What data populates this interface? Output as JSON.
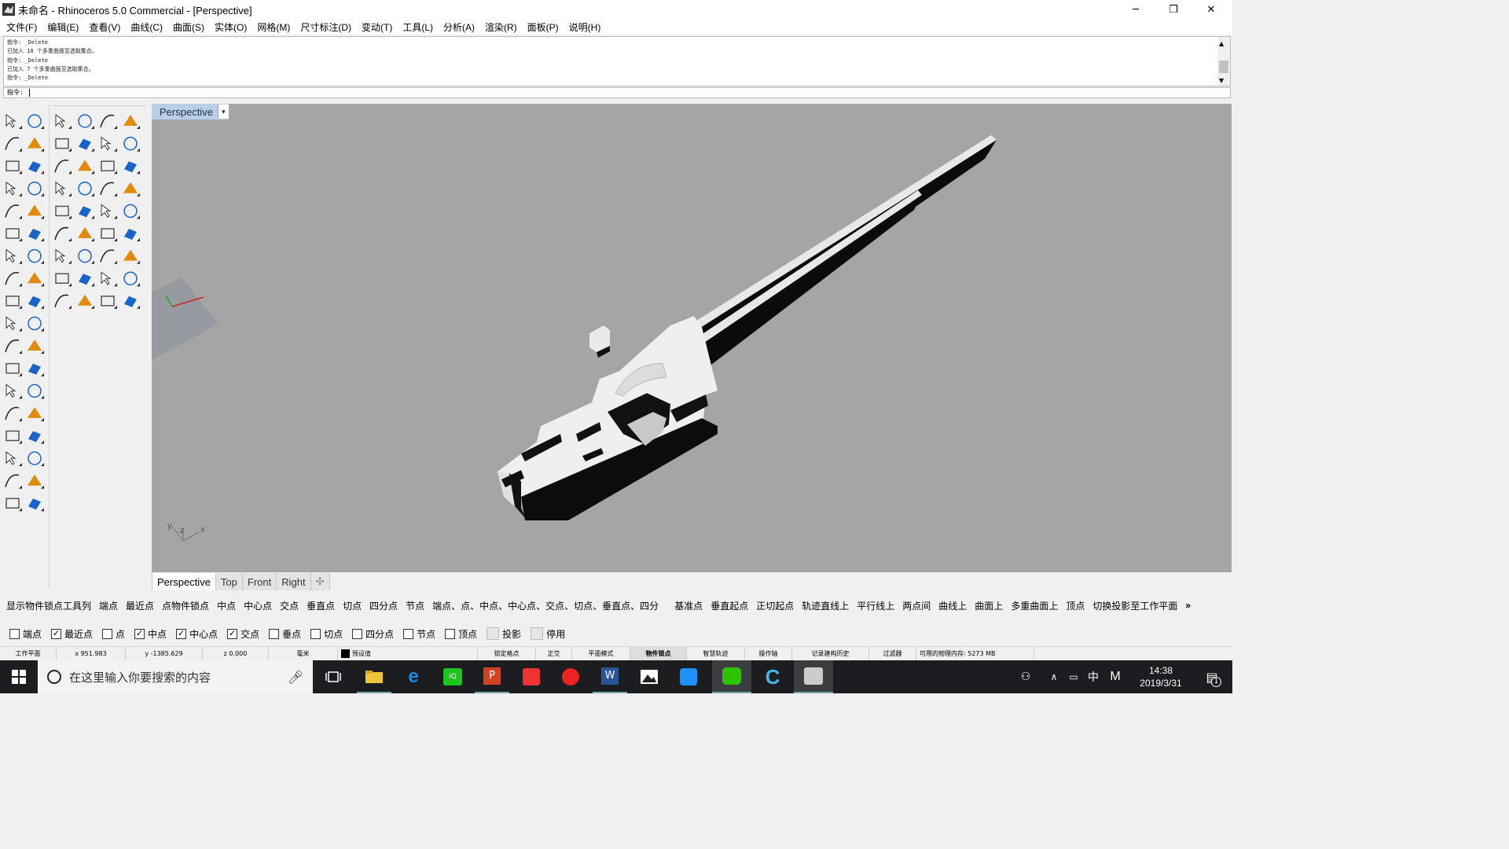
{
  "window": {
    "title": "未命名 - Rhinoceros 5.0 Commercial - [Perspective]",
    "minimize_glyph": "─",
    "restore_glyph": "❐",
    "close_glyph": "✕"
  },
  "menu": [
    "文件(F)",
    "编辑(E)",
    "查看(V)",
    "曲线(C)",
    "曲面(S)",
    "实体(O)",
    "网格(M)",
    "尺寸标注(D)",
    "变动(T)",
    "工具(L)",
    "分析(A)",
    "渲染(R)",
    "面板(P)",
    "说明(H)"
  ],
  "command_history": [
    "指令: _Delete",
    "已加入 10 个多重曲面至选取集合。",
    "指令: _Delete",
    "已加入 7 个多重曲面至选取集合。",
    "指令: _Delete"
  ],
  "command_prompt": "指令:",
  "viewport": {
    "title": "Perspective",
    "dropdown_glyph": "▾",
    "background_color": "#a5a5a5",
    "axis_labels": {
      "x": "x",
      "y": "y",
      "z": "z"
    }
  },
  "view_tabs": [
    "Perspective",
    "Top",
    "Front",
    "Right"
  ],
  "view_tab_add_glyph": "✣",
  "osnap_toolbar": {
    "items": [
      "显示物件锁点工具列",
      "端点",
      "最近点",
      "点物件锁点",
      "中点",
      "中心点",
      "交点",
      "垂直点",
      "切点",
      "四分点",
      "节点",
      "端点、点、中点、中心点、交点、切点、垂直点、四分",
      "基准点",
      "垂直起点",
      "正切起点",
      "轨迹直线上",
      "平行线上",
      "两点间",
      "曲线上",
      "曲面上",
      "多重曲面上",
      "顶点",
      "切换投影至工作平面"
    ],
    "more_glyph": "»"
  },
  "osnap_checks": [
    {
      "label": "端点",
      "checked": false
    },
    {
      "label": "最近点",
      "checked": true
    },
    {
      "label": "点",
      "checked": false
    },
    {
      "label": "中点",
      "checked": true
    },
    {
      "label": "中心点",
      "checked": true
    },
    {
      "label": "交点",
      "checked": true
    },
    {
      "label": "垂点",
      "checked": false
    },
    {
      "label": "切点",
      "checked": false
    },
    {
      "label": "四分点",
      "checked": false
    },
    {
      "label": "节点",
      "checked": false
    },
    {
      "label": "顶点",
      "checked": false
    },
    {
      "label": "投影",
      "checked": false
    },
    {
      "label": "停用",
      "checked": false
    }
  ],
  "status": {
    "cplane": "工作平面",
    "x": "x 951.983",
    "y": "y -1385.629",
    "z": "z 0.000",
    "units": "毫米",
    "layer": "预设值",
    "layer_color": "#000000",
    "grid_snap": "锁定格点",
    "ortho": "正交",
    "planar": "平面模式",
    "osnap": "物件锁点",
    "smarttrack": "智慧轨迹",
    "gumball": "操作轴",
    "history": "记录建构历史",
    "filter": "过滤器",
    "memory": "可用的物理内存: 5273 MB"
  },
  "taskbar": {
    "search_placeholder": "在这里输入你要搜索的内容",
    "time": "14:38",
    "date": "2019/3/31",
    "ime": "中",
    "ime2": "M",
    "notifications": "1",
    "start_color": "#ffffff"
  }
}
